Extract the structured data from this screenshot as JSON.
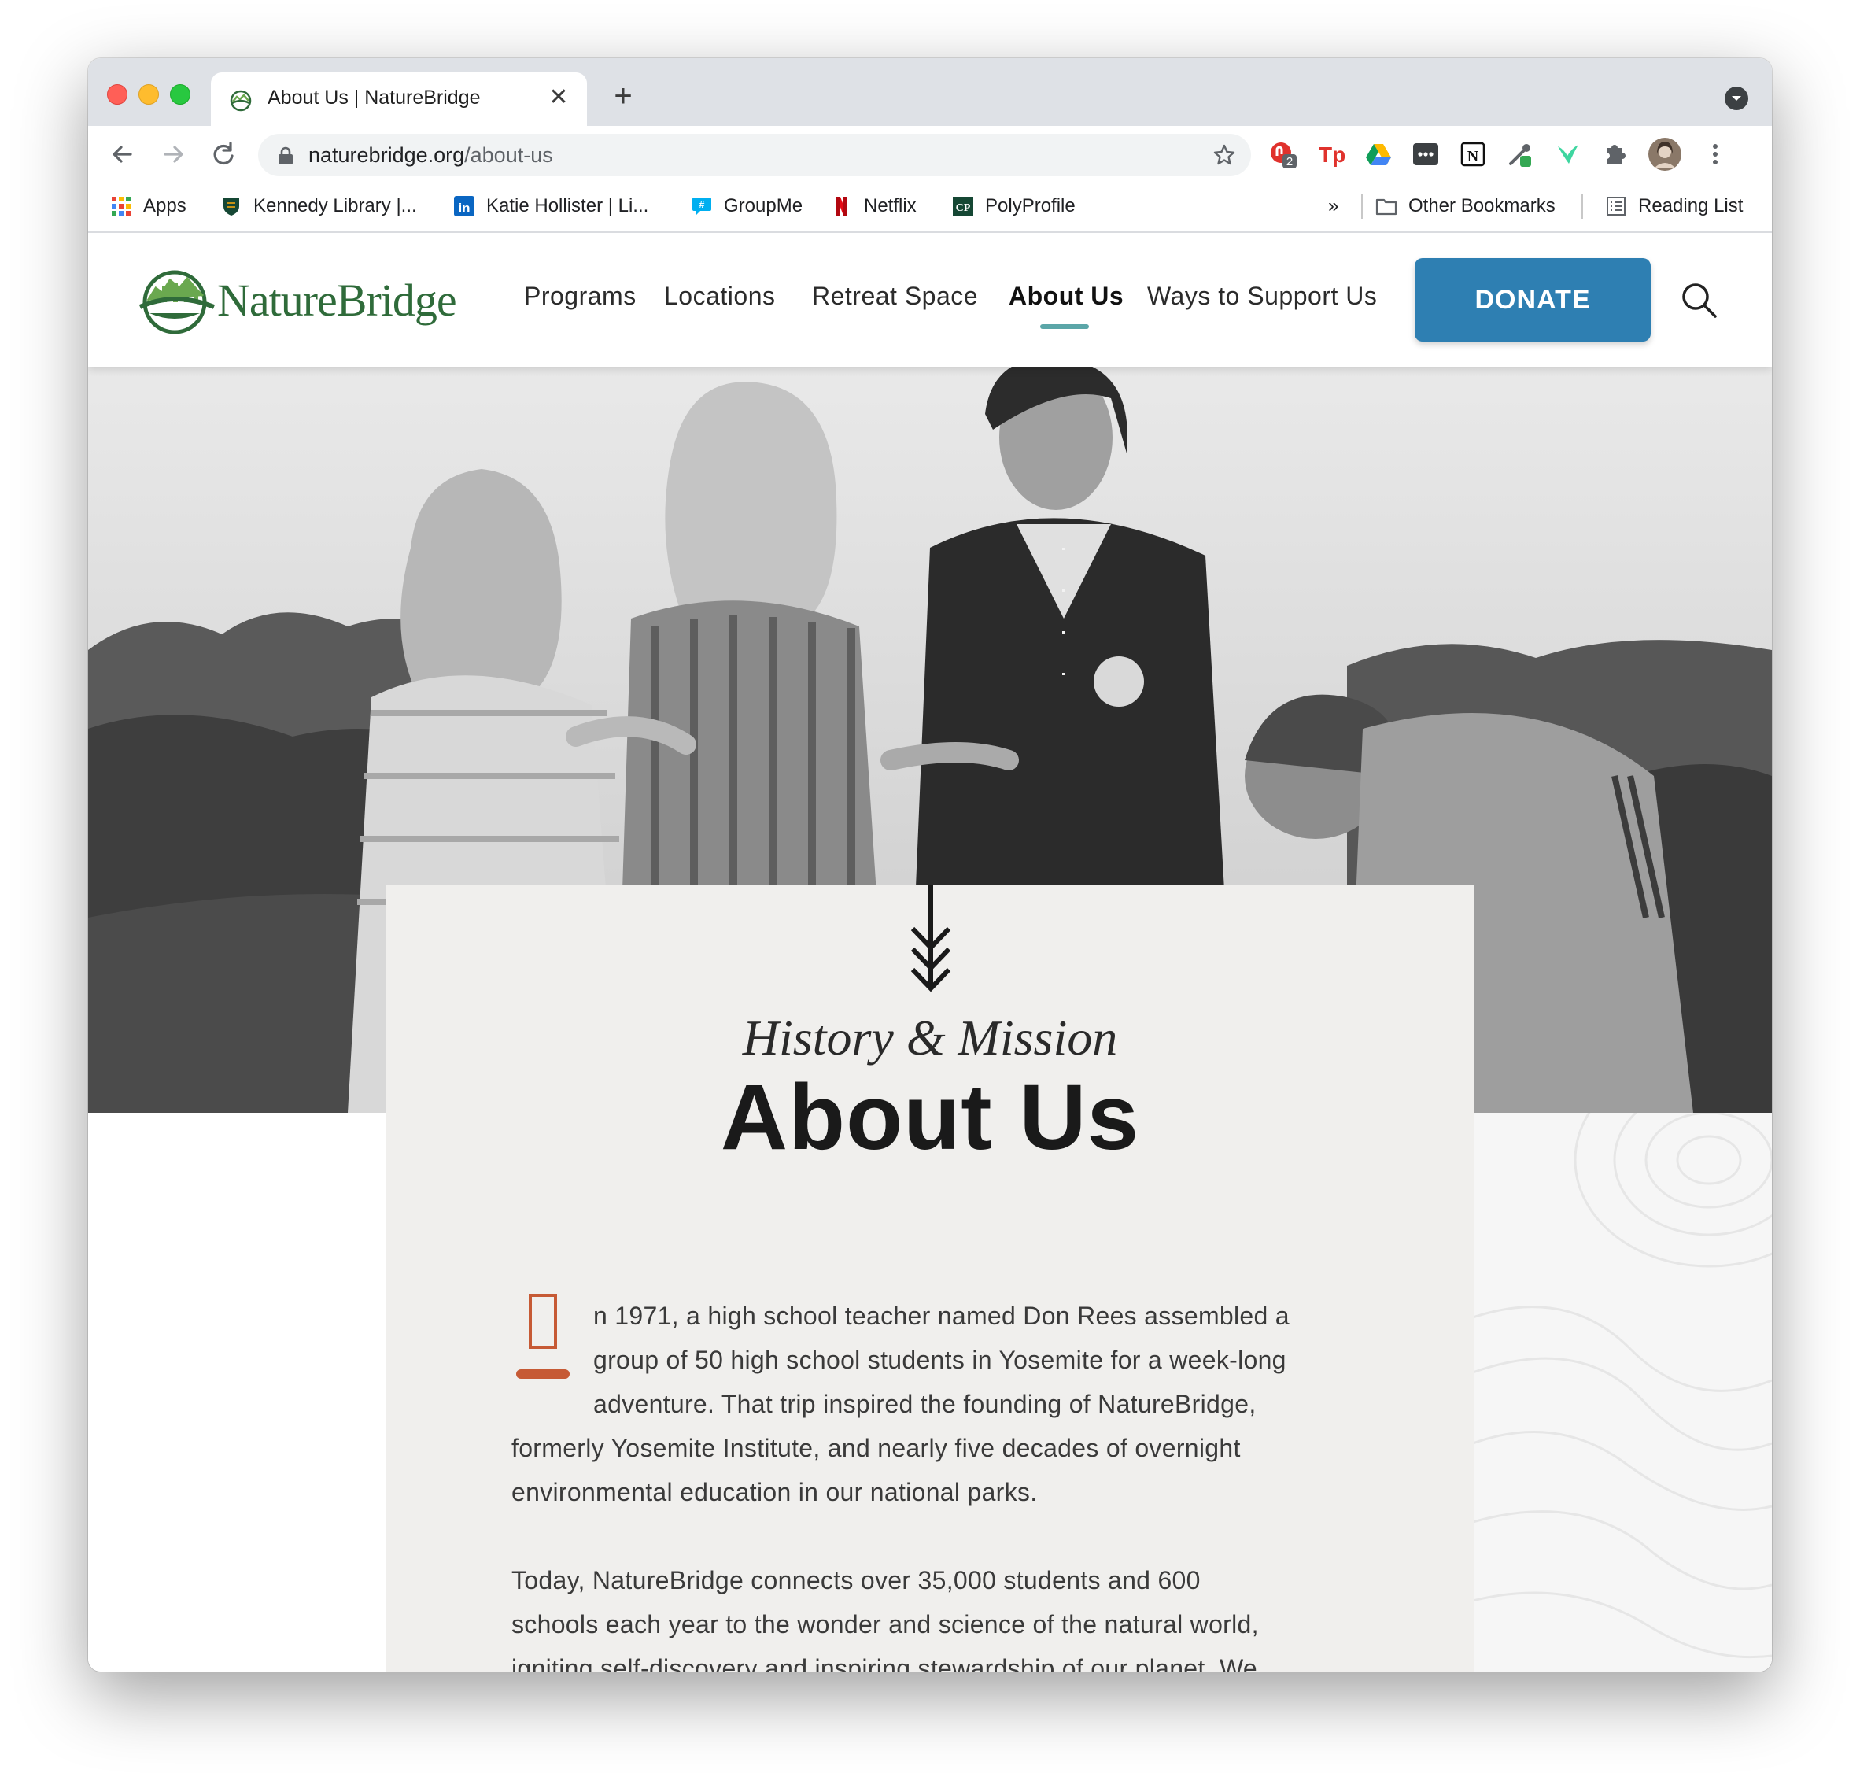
{
  "browser": {
    "tab_title": "About Us | NatureBridge",
    "url_domain": "naturebridge.org",
    "url_path": "/about-us",
    "extension_badge": "2",
    "bookmarks": [
      {
        "label": "Apps"
      },
      {
        "label": "Kennedy Library |..."
      },
      {
        "label": "Katie Hollister | Li..."
      },
      {
        "label": "GroupMe"
      },
      {
        "label": "Netflix"
      },
      {
        "label": "PolyProfile"
      }
    ],
    "overflow": "»",
    "other_bookmarks": "Other Bookmarks",
    "reading_list": "Reading List"
  },
  "site": {
    "logo_text": "NatureBridge",
    "nav": [
      "Programs",
      "Locations",
      "Retreat Space",
      "About Us",
      "Ways to Support Us"
    ],
    "active_nav": "About Us",
    "donate_label": "DONATE"
  },
  "hero": {
    "eyebrow": "History & Mission",
    "title": "About Us"
  },
  "content": {
    "dropcap": "I",
    "paragraph1_lines": [
      "n 1971, a high school teacher named Don Rees assembled a",
      "group of 50 high school students in Yosemite for a week-long",
      "adventure. That trip inspired the founding of NatureBridge,"
    ],
    "paragraph1_rest": [
      "formerly Yosemite Institute, and nearly five decades of overnight",
      "environmental education in our national parks."
    ],
    "paragraph2_lines": [
      "Today, NatureBridge connects over 35,000 students and 600",
      "schools each year to the wonder and science of the natural world,",
      "igniting self-discovery and inspiring stewardship of our planet. We"
    ]
  },
  "colors": {
    "accent_blue": "#2e7fb2",
    "logo_green": "#2f6b3a",
    "nav_underline": "#5ba6a8",
    "dropcap_orange": "#c65a35",
    "card_bg": "#f0efed"
  }
}
